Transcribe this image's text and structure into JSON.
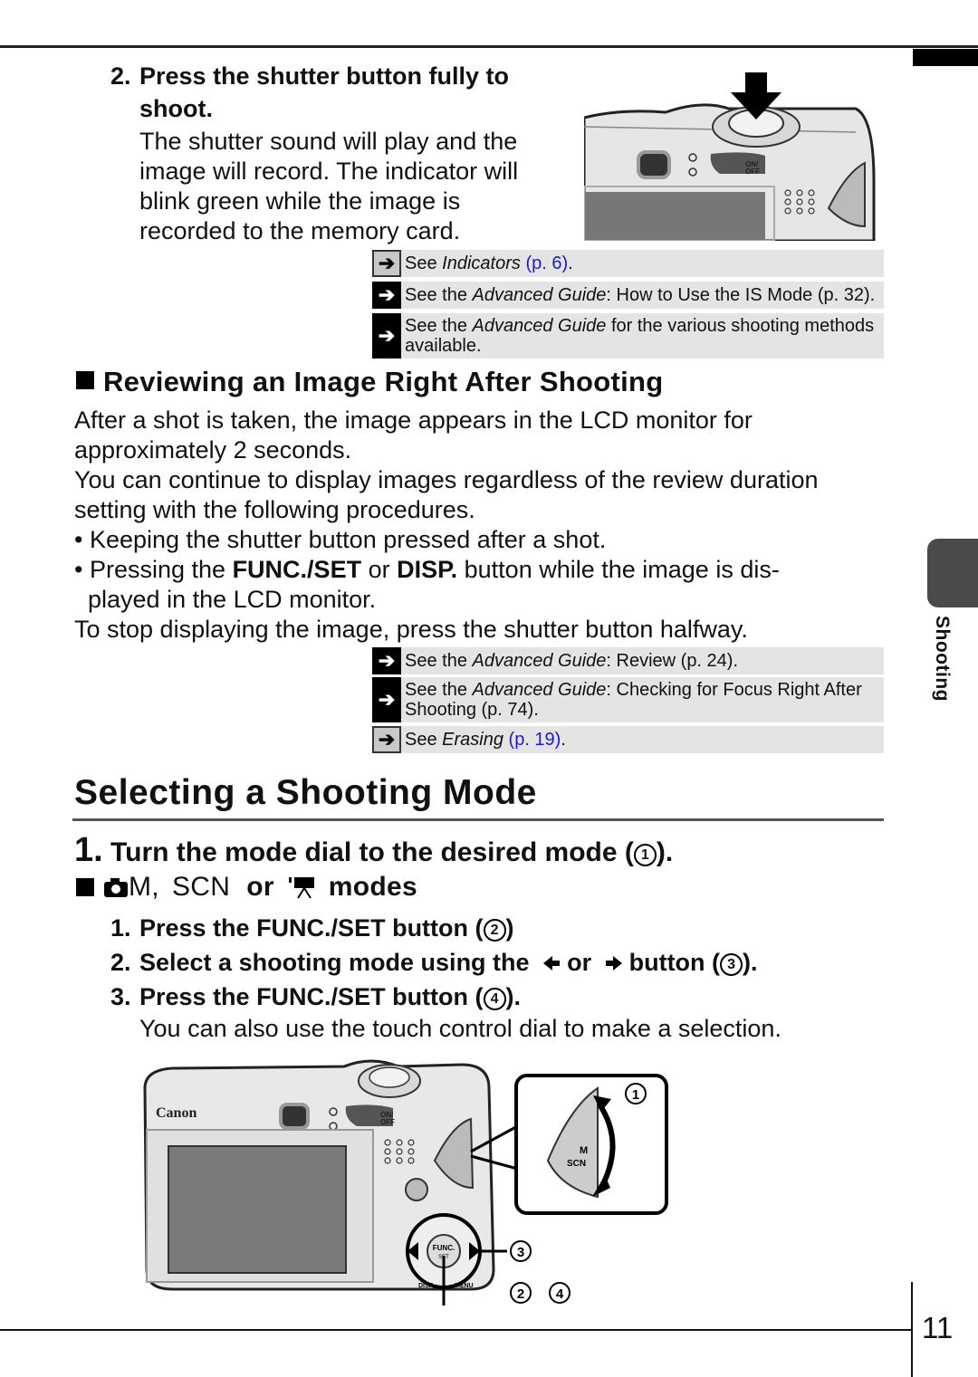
{
  "step2": {
    "number": "2.",
    "heading_line1": "Press the shutter button fully to",
    "heading_line2": "shoot.",
    "body_lines": [
      "The shutter sound will play and the",
      "image will record. The indicator will",
      "blink green while the image is",
      "recorded to the memory card."
    ]
  },
  "refs_top": [
    {
      "icon": "arrow-right-icon",
      "arrow": "➔",
      "pre": "See ",
      "italic": "Indicators",
      "mid": " ",
      "page": "(p. 6)",
      "post": ".",
      "style": "light"
    },
    {
      "icon": "arrow-right-icon",
      "arrow": "➔",
      "pre": "See the ",
      "italic": "Advanced Guide",
      "mid": ": How to Use the IS Mode (p. 32).",
      "page": "",
      "post": "",
      "style": "dark"
    },
    {
      "icon": "arrow-right-icon",
      "arrow": "➔",
      "pre": "See the ",
      "italic": "Advanced Guide",
      "mid": " for the various shooting methods",
      "line2": "available.",
      "page": "",
      "post": "",
      "style": "dark"
    }
  ],
  "review": {
    "heading": "Reviewing an Image Right After Shooting",
    "para1_l1": "After a shot is taken, the image appears in the LCD monitor for",
    "para1_l2": "approximately 2 seconds.",
    "para2_l1": "You can continue to display images regardless of the review duration",
    "para2_l2": "setting with the following procedures.",
    "bullet1": "Keeping the shutter button pressed after a shot.",
    "bullet2_pre": "Pressing the ",
    "bullet2_b1": "FUNC./SET",
    "bullet2_mid": " or ",
    "bullet2_b2": "DISP.",
    "bullet2_post": " button while the image is dis-",
    "bullet2_l2": "played in the LCD monitor.",
    "stop": "To stop displaying the image, press the shutter button halfway."
  },
  "refs_bottom": [
    {
      "arrow": "➔",
      "pre": "See the ",
      "italic": "Advanced Guide",
      "mid": ": Review (p. 24).",
      "page": "",
      "post": "",
      "style": "dark"
    },
    {
      "arrow": "➔",
      "pre": "See the ",
      "italic": "Advanced Guide",
      "mid": ": Checking for Focus Right After",
      "line2": "Shooting (p. 74).",
      "page": "",
      "post": "",
      "style": "dark"
    },
    {
      "arrow": "➔",
      "pre": "See ",
      "italic": "Erasing",
      "mid": " ",
      "page": "(p. 19)",
      "post": ".",
      "style": "light"
    }
  ],
  "selecting": {
    "title": "Selecting a Shooting Mode",
    "step1_num": "1.",
    "step1_text": "Turn the mode dial to the desired mode (",
    "step1_circ": "1",
    "step1_end": ").",
    "modes_heading_m": "M,",
    "modes_heading_scn": "SCN",
    "modes_heading_or": "or",
    "modes_heading_end": "modes",
    "substeps": [
      {
        "num": "1.",
        "pre": "Press the FUNC./SET button (",
        "circ": "2",
        "post": ")"
      },
      {
        "num": "2.",
        "pre": "Select a shooting mode using the",
        "left_arrow": "◆",
        "or": "or",
        "right_arrow": "◆",
        "mid": "button (",
        "circ": "3",
        "post": ")."
      },
      {
        "num": "3.",
        "pre": "Press the FUNC./SET button (",
        "circ": "4",
        "post": ")."
      }
    ],
    "note": "You can also use the touch control dial to make a selection."
  },
  "illustration": {
    "brand": "Canon",
    "on_off": "ON/\nOFF",
    "func_label": "FUNC.",
    "set_label": "SET",
    "disp_label": "DISP.",
    "menu_label": "MENU",
    "dial_m": "M",
    "dial_scn": "SCN",
    "callouts": [
      "1",
      "2",
      "3",
      "4"
    ]
  },
  "side_tab": {
    "label": "Shooting"
  },
  "page_number": "11"
}
